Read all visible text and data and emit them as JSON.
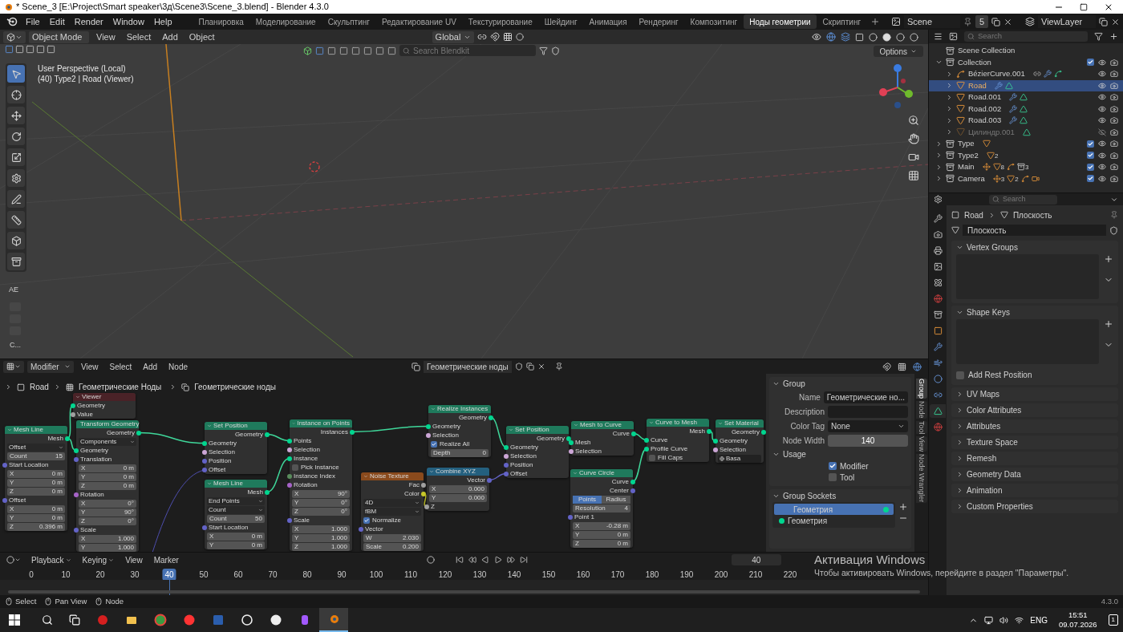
{
  "title_bar": {
    "title": "* Scene_3 [E:\\Project\\Smart speaker\\3д\\Scene3\\Scene_3.blend] - Blender 4.3.0"
  },
  "menu": [
    "File",
    "Edit",
    "Render",
    "Window",
    "Help"
  ],
  "workspaces": [
    {
      "label": "Планировка",
      "selected": false
    },
    {
      "label": "Моделирование",
      "selected": false
    },
    {
      "label": "Скульптинг",
      "selected": false
    },
    {
      "label": "Редактирование UV",
      "selected": false
    },
    {
      "label": "Текстурирование",
      "selected": false
    },
    {
      "label": "Шейдинг",
      "selected": false
    },
    {
      "label": "Анимация",
      "selected": false
    },
    {
      "label": "Рендеринг",
      "selected": false
    },
    {
      "label": "Композитинг",
      "selected": false
    },
    {
      "label": "Ноды геометрии",
      "selected": true
    },
    {
      "label": "Скриптинг",
      "selected": false
    }
  ],
  "scene": {
    "name": "Scene",
    "count": "5",
    "view_layer": "ViewLayer"
  },
  "viewport": {
    "mode": "Object Mode",
    "menus": [
      "View",
      "Select",
      "Add",
      "Object"
    ],
    "orientation": "Global",
    "search_placeholder": "Search Blendkit",
    "options": "Options",
    "info": [
      "User Perspective (Local)",
      "(40) Type2 | Road (Viewer)"
    ],
    "panel_label": "AE",
    "panel_footer": "C...",
    "tools": [
      {
        "kind": "select",
        "selected": true
      },
      {
        "kind": "cursor",
        "selected": false
      },
      {
        "kind": "move",
        "selected": false
      },
      {
        "kind": "rotate",
        "selected": false
      },
      {
        "kind": "scale",
        "selected": false
      },
      {
        "kind": "transform",
        "selected": false
      },
      {
        "kind": "annotate",
        "selected": false
      },
      {
        "kind": "measure",
        "selected": false
      },
      {
        "kind": "add",
        "selected": false
      },
      {
        "kind": "extrude",
        "selected": false
      }
    ]
  },
  "node_editor": {
    "mode": "Modifier",
    "menus": [
      "View",
      "Select",
      "Add",
      "Node"
    ],
    "tree": "Геометрические ноды",
    "breadcrumbs": [
      "Road",
      "Геометрические Ноды",
      "Геометрические ноды"
    ],
    "nodes": [
      {
        "title": "Viewer",
        "kind": "viewer",
        "rows": [
          {
            "kind": "input",
            "label": "Geometry",
            "color": "#00d68f"
          },
          {
            "kind": "input",
            "label": "Value",
            "color": "#a1a1a1"
          }
        ]
      },
      {
        "title": "Mesh Line",
        "kind": "geometry",
        "rows": [
          {
            "kind": "output",
            "label": "Mesh",
            "color": "#00d68f"
          },
          {
            "kind": "dropdown",
            "label": "Offset"
          },
          {
            "kind": "field",
            "label": "Count",
            "value": "15"
          },
          {
            "kind": "input",
            "label": "Start Location",
            "color": "#6363c7"
          },
          {
            "kind": "field",
            "label": "X",
            "value": "0 m"
          },
          {
            "kind": "field",
            "label": "Y",
            "value": "0 m"
          },
          {
            "kind": "field",
            "label": "Z",
            "value": "0 m"
          },
          {
            "kind": "input",
            "label": "Offset",
            "color": "#6363c7"
          },
          {
            "kind": "field",
            "label": "X",
            "value": "0 m"
          },
          {
            "kind": "field",
            "label": "Y",
            "value": "0 m"
          },
          {
            "kind": "field",
            "label": "Z",
            "value": "0.396 m"
          }
        ]
      },
      {
        "title": "Transform Geometry",
        "kind": "geometry",
        "rows": [
          {
            "kind": "output",
            "label": "Geometry",
            "color": "#00d68f"
          },
          {
            "kind": "dropdown",
            "label": "Components"
          },
          {
            "kind": "input",
            "label": "Geometry",
            "color": "#00d68f"
          },
          {
            "kind": "input",
            "label": "Translation",
            "color": "#6363c7"
          },
          {
            "kind": "field",
            "label": "X",
            "value": "0 m"
          },
          {
            "kind": "field",
            "label": "Y",
            "value": "0 m"
          },
          {
            "kind": "field",
            "label": "Z",
            "value": "0 m"
          },
          {
            "kind": "input",
            "label": "Rotation",
            "color": "#a663c7"
          },
          {
            "kind": "field",
            "label": "X",
            "value": "0°"
          },
          {
            "kind": "field",
            "label": "Y",
            "value": "90°"
          },
          {
            "kind": "field",
            "label": "Z",
            "value": "0°"
          },
          {
            "kind": "input",
            "label": "Scale",
            "color": "#6363c7"
          },
          {
            "kind": "field",
            "label": "X",
            "value": "1.000"
          },
          {
            "kind": "field",
            "label": "Y",
            "value": "1.000"
          }
        ]
      },
      {
        "title": "Set Position",
        "kind": "geometry",
        "rows": [
          {
            "kind": "output",
            "label": "Geometry",
            "color": "#00d68f"
          },
          {
            "kind": "input",
            "label": "Geometry",
            "color": "#00d68f"
          },
          {
            "kind": "input",
            "label": "Selection",
            "color": "#cca6d6"
          },
          {
            "kind": "input",
            "label": "Position",
            "color": "#6363c7"
          },
          {
            "kind": "input",
            "label": "Offset",
            "color": "#6363c7"
          }
        ]
      },
      {
        "title": "Mesh Line",
        "kind": "geometry",
        "rows": [
          {
            "kind": "output",
            "label": "Mesh",
            "color": "#00d68f"
          },
          {
            "kind": "dropdown",
            "label": "End Points"
          },
          {
            "kind": "dropdown",
            "label": "Count"
          },
          {
            "kind": "field",
            "label": "Count",
            "value": "50"
          },
          {
            "kind": "input",
            "label": "Start Location",
            "color": "#6363c7"
          },
          {
            "kind": "field",
            "label": "X",
            "value": "0 m"
          },
          {
            "kind": "field",
            "label": "Y",
            "value": "0 m"
          }
        ]
      },
      {
        "title": "Instance on Points",
        "kind": "geometry",
        "rows": [
          {
            "kind": "output",
            "label": "Instances",
            "color": "#00d68f"
          },
          {
            "kind": "input",
            "label": "Points",
            "color": "#00d68f"
          },
          {
            "kind": "input",
            "label": "Selection",
            "color": "#cca6d6"
          },
          {
            "kind": "input",
            "label": "Instance",
            "color": "#00d68f"
          },
          {
            "kind": "checkbox",
            "label": "Pick Instance",
            "checked": false
          },
          {
            "kind": "input",
            "label": "Instance Index",
            "color": "#598c5c"
          },
          {
            "kind": "input",
            "label": "Rotation",
            "color": "#a663c7"
          },
          {
            "kind": "field",
            "label": "X",
            "value": "90°"
          },
          {
            "kind": "field",
            "label": "Y",
            "value": "0°"
          },
          {
            "kind": "field",
            "label": "Z",
            "value": "0°"
          },
          {
            "kind": "input",
            "label": "Scale",
            "color": "#6363c7"
          },
          {
            "kind": "field",
            "label": "X",
            "value": "1.000"
          },
          {
            "kind": "field",
            "label": "Y",
            "value": "1.000"
          },
          {
            "kind": "field",
            "label": "Z",
            "value": "1.000"
          }
        ]
      },
      {
        "title": "Noise Texture",
        "kind": "texture",
        "rows": [
          {
            "kind": "output",
            "label": "Fac",
            "color": "#a1a1a1"
          },
          {
            "kind": "output",
            "label": "Color",
            "color": "#c7c729"
          },
          {
            "kind": "dropdown",
            "label": "4D"
          },
          {
            "kind": "dropdown",
            "label": "fBM"
          },
          {
            "kind": "checkbox",
            "label": "Normalize",
            "checked": true
          },
          {
            "kind": "input",
            "label": "Vector",
            "color": "#6363c7"
          },
          {
            "kind": "field",
            "label": "W",
            "value": "2.030"
          },
          {
            "kind": "field",
            "label": "Scale",
            "value": "0.200"
          }
        ]
      },
      {
        "title": "Realize Instances",
        "kind": "geometry",
        "rows": [
          {
            "kind": "output",
            "label": "Geometry",
            "color": "#00d68f"
          },
          {
            "kind": "input",
            "label": "Geometry",
            "color": "#00d68f"
          },
          {
            "kind": "input",
            "label": "Selection",
            "color": "#cca6d6"
          },
          {
            "kind": "checkbox",
            "label": "Realize All",
            "checked": true
          },
          {
            "kind": "field",
            "label": "Depth",
            "value": "0"
          }
        ]
      },
      {
        "title": "Combine XYZ",
        "kind": "converter",
        "rows": [
          {
            "kind": "output",
            "label": "Vector",
            "color": "#6363c7"
          },
          {
            "kind": "field",
            "label": "X",
            "value": "0.000"
          },
          {
            "kind": "field",
            "label": "Y",
            "value": "0.000"
          },
          {
            "kind": "input",
            "label": "Z",
            "color": "#a1a1a1"
          }
        ]
      },
      {
        "title": "Set Position",
        "kind": "geometry",
        "rows": [
          {
            "kind": "output",
            "label": "Geometry",
            "color": "#00d68f"
          },
          {
            "kind": "input",
            "label": "Geometry",
            "color": "#00d68f"
          },
          {
            "kind": "input",
            "label": "Selection",
            "color": "#cca6d6"
          },
          {
            "kind": "input",
            "label": "Position",
            "color": "#6363c7"
          },
          {
            "kind": "input",
            "label": "Offset",
            "color": "#6363c7"
          }
        ]
      },
      {
        "title": "Mesh to Curve",
        "kind": "geometry",
        "rows": [
          {
            "kind": "output",
            "label": "Curve",
            "color": "#00d68f"
          },
          {
            "kind": "input",
            "label": "Mesh",
            "color": "#00d68f"
          },
          {
            "kind": "input",
            "label": "Selection",
            "color": "#cca6d6"
          }
        ]
      },
      {
        "title": "Curve Circle",
        "kind": "geometry",
        "rows": [
          {
            "kind": "output",
            "label": "Curve",
            "color": "#00d68f"
          },
          {
            "kind": "output",
            "label": "Center",
            "color": "#6363c7"
          },
          {
            "kind": "toggle",
            "options": [
              {
                "label": "Points",
                "selected": true
              },
              {
                "label": "Radius",
                "selected": false
              }
            ]
          },
          {
            "kind": "field",
            "label": "Resolution",
            "value": "4"
          },
          {
            "kind": "input",
            "label": "Point 1",
            "color": "#6363c7"
          },
          {
            "kind": "field",
            "label": "X",
            "value": "-0.28 m"
          },
          {
            "kind": "field",
            "label": "Y",
            "value": "0 m"
          },
          {
            "kind": "field",
            "label": "Z",
            "value": "0 m"
          }
        ]
      },
      {
        "title": "Curve to Mesh",
        "kind": "geometry",
        "rows": [
          {
            "kind": "output",
            "label": "Mesh",
            "color": "#00d68f"
          },
          {
            "kind": "input",
            "label": "Curve",
            "color": "#00d68f"
          },
          {
            "kind": "input",
            "label": "Profile Curve",
            "color": "#00d68f"
          },
          {
            "kind": "checkbox",
            "label": "Fill Caps",
            "checked": false
          }
        ]
      },
      {
        "title": "Set Material",
        "kind": "geometry",
        "rows": [
          {
            "kind": "output",
            "label": "Geometry",
            "color": "#00d68f"
          },
          {
            "kind": "input",
            "label": "Geometry",
            "color": "#00d68f"
          },
          {
            "kind": "input",
            "label": "Selection",
            "color": "#cca6d6"
          },
          {
            "kind": "material",
            "label": "Basa"
          }
        ]
      }
    ]
  },
  "node_sidebar": {
    "tabs": [
      {
        "label": "Group",
        "selected": true
      },
      {
        "label": "Node",
        "selected": false
      },
      {
        "label": "Tool",
        "selected": false
      },
      {
        "label": "View",
        "selected": false
      },
      {
        "label": "Node Wrangler",
        "selected": false
      }
    ],
    "group": {
      "title": "Group",
      "fields": [
        {
          "label": "Name",
          "kind": "text",
          "value": "Геометрические но..."
        },
        {
          "label": "Description",
          "kind": "text"
        },
        {
          "label": "Color Tag",
          "kind": "dropdown",
          "value": "None"
        },
        {
          "label": "Node Width",
          "kind": "number",
          "value": "140"
        }
      ],
      "usage": {
        "title": "Usage",
        "options": [
          {
            "label": "Modifier",
            "checked": true
          },
          {
            "label": "Tool",
            "checked": false
          }
        ]
      }
    },
    "sockets": {
      "title": "Group Sockets",
      "items": [
        {
          "label": "Геометрия",
          "selected": true
        },
        {
          "label": "Геометрия",
          "selected": false
        }
      ]
    }
  },
  "outliner": {
    "search_placeholder": "Search",
    "tree": [
      {
        "name": "Scene Collection",
        "kind": "scene",
        "selected": false,
        "children": [
          {
            "name": "Collection",
            "kind": "collection",
            "selected": false,
            "expanded": true,
            "checked": true,
            "children": [
              {
                "name": "BézierCurve.001",
                "kind": "curve",
                "selected": false,
                "expanded": false,
                "hidden": false,
                "badges": [
                  {
                    "kind": "hook"
                  },
                  {
                    "kind": "modifier"
                  },
                  {
                    "kind": "curve_data"
                  }
                ]
              },
              {
                "name": "Road",
                "kind": "mesh",
                "selected": true,
                "expanded": false,
                "hidden": false,
                "badges": [
                  {
                    "kind": "modifier"
                  },
                  {
                    "kind": "mesh_data"
                  }
                ]
              },
              {
                "name": "Road.001",
                "kind": "mesh",
                "selected": false,
                "expanded": false,
                "hidden": false,
                "badges": [
                  {
                    "kind": "modifier"
                  },
                  {
                    "kind": "mesh_data"
                  }
                ]
              },
              {
                "name": "Road.002",
                "kind": "mesh",
                "selected": false,
                "expanded": false,
                "hidden": false,
                "badges": [
                  {
                    "kind": "modifier"
                  },
                  {
                    "kind": "mesh_data"
                  }
                ]
              },
              {
                "name": "Road.003",
                "kind": "mesh",
                "selected": false,
                "expanded": false,
                "hidden": false,
                "badges": [
                  {
                    "kind": "modifier"
                  },
                  {
                    "kind": "mesh_data"
                  }
                ]
              },
              {
                "name": "Цилиндр.001",
                "kind": "mesh",
                "selected": false,
                "expanded": false,
                "hidden": true,
                "badges": [
                  {
                    "kind": "mesh_data"
                  }
                ]
              }
            ]
          },
          {
            "name": "Type",
            "kind": "collection",
            "selected": false,
            "expanded": false,
            "checked": true,
            "badges": [
              {
                "kind": "mesh"
              }
            ]
          },
          {
            "name": "Type2",
            "kind": "collection",
            "selected": false,
            "expanded": false,
            "checked": true,
            "badges": [
              {
                "kind": "mesh",
                "count": "2"
              }
            ]
          },
          {
            "name": "Main",
            "kind": "collection",
            "selected": false,
            "expanded": false,
            "checked": true,
            "badges": [
              {
                "kind": "empty"
              },
              {
                "kind": "mesh",
                "count": "8"
              },
              {
                "kind": "curve"
              },
              {
                "kind": "collection",
                "count": "3"
              }
            ]
          },
          {
            "name": "Camera",
            "kind": "collection",
            "selected": false,
            "expanded": false,
            "checked": true,
            "badges": [
              {
                "kind": "empty",
                "count": "3"
              },
              {
                "kind": "mesh",
                "count": "2"
              },
              {
                "kind": "curve"
              },
              {
                "kind": "camera"
              }
            ]
          }
        ]
      }
    ]
  },
  "properties": {
    "search_placeholder": "Search",
    "breadcrumbs": [
      "Road",
      "Плоскость"
    ],
    "datablock": "Плоскость",
    "tabs": [
      {
        "kind": "tool",
        "selected": false
      },
      {
        "kind": "render",
        "selected": false
      },
      {
        "kind": "output",
        "selected": false
      },
      {
        "kind": "view_layer",
        "selected": false
      },
      {
        "kind": "scene",
        "selected": false
      },
      {
        "kind": "world",
        "selected": false
      },
      {
        "kind": "collection",
        "selected": false
      },
      {
        "kind": "object",
        "selected": false
      },
      {
        "kind": "modifier",
        "selected": false
      },
      {
        "kind": "particles",
        "selected": false
      },
      {
        "kind": "physics",
        "selected": false
      },
      {
        "kind": "constraints",
        "selected": false
      },
      {
        "kind": "data",
        "selected": true
      },
      {
        "kind": "material",
        "selected": false
      }
    ],
    "panels": [
      {
        "title": "Vertex Groups",
        "expanded": true
      },
      {
        "title": "Shape Keys",
        "expanded": true,
        "option": {
          "label": "Add Rest Position",
          "checked": false
        }
      },
      {
        "title": "UV Maps",
        "expanded": false
      },
      {
        "title": "Color Attributes",
        "expanded": false
      },
      {
        "title": "Attributes",
        "expanded": false
      },
      {
        "title": "Texture Space",
        "expanded": false
      },
      {
        "title": "Remesh",
        "expanded": false
      },
      {
        "title": "Geometry Data",
        "expanded": false
      },
      {
        "title": "Animation",
        "expanded": false
      },
      {
        "title": "Custom Properties",
        "expanded": false
      }
    ]
  },
  "timeline": {
    "menus": [
      "Playback",
      "Keying",
      "View",
      "Marker"
    ],
    "current_frame": "40",
    "ruler": [
      {
        "label": "0",
        "selected": false
      },
      {
        "label": "10",
        "selected": false
      },
      {
        "label": "20",
        "selected": false
      },
      {
        "label": "30",
        "selected": false
      },
      {
        "label": "40",
        "selected": true
      },
      {
        "label": "50",
        "selected": false
      },
      {
        "label": "60",
        "selected": false
      },
      {
        "label": "70",
        "selected": false
      },
      {
        "label": "80",
        "selected": false
      },
      {
        "label": "90",
        "selected": false
      },
      {
        "label": "100",
        "selected": false
      },
      {
        "label": "110",
        "selected": false
      },
      {
        "label": "120",
        "selected": false
      },
      {
        "label": "130",
        "selected": false
      },
      {
        "label": "140",
        "selected": false
      },
      {
        "label": "150",
        "selected": false
      },
      {
        "label": "160",
        "selected": false
      },
      {
        "label": "170",
        "selected": false
      },
      {
        "label": "180",
        "selected": false
      },
      {
        "label": "190",
        "selected": false
      },
      {
        "label": "200",
        "selected": false
      },
      {
        "label": "210",
        "selected": false
      },
      {
        "label": "220",
        "selected": false
      }
    ]
  },
  "status_bar": {
    "items": [
      "Select",
      "Pan View",
      "Node"
    ],
    "version": "4.3.0"
  },
  "watermark": {
    "title": "Активация Windows",
    "text": "Чтобы активировать Windows, перейдите в раздел \"Параметры\"."
  },
  "taskbar": {
    "apps": [
      {
        "kind": "record",
        "selected": false
      },
      {
        "kind": "folder",
        "selected": false
      },
      {
        "kind": "browser",
        "selected": false
      },
      {
        "kind": "yandex",
        "selected": false
      },
      {
        "kind": "word",
        "selected": false
      },
      {
        "kind": "unreal",
        "selected": false
      },
      {
        "kind": "yabrowser",
        "selected": false
      },
      {
        "kind": "figma",
        "selected": false
      },
      {
        "kind": "blender",
        "selected": true
      }
    ],
    "language": "ENG",
    "time": "15:51",
    "date": "09.07.2026",
    "notifications": "1"
  }
}
